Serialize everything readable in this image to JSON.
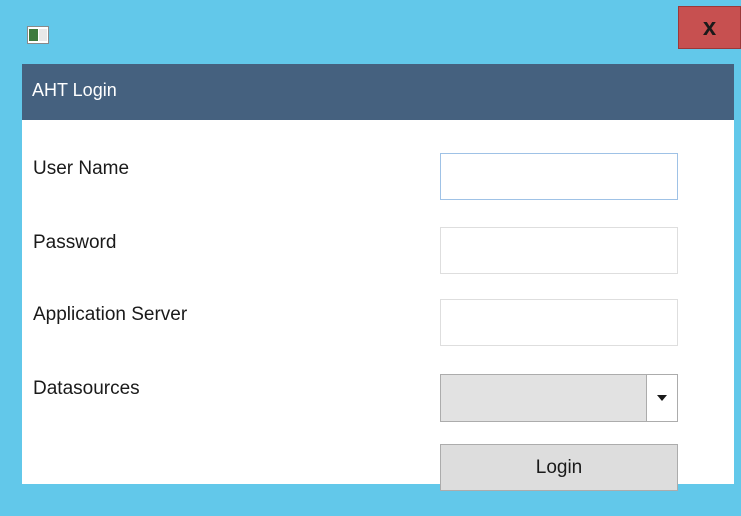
{
  "window": {
    "icon": "app-window-icon",
    "close_icon": "close-icon",
    "close_glyph": "x",
    "frame_color": "#62c8ea",
    "close_color": "#c75050"
  },
  "header": {
    "title": "AHT Login",
    "color": "#45617f"
  },
  "form": {
    "username": {
      "label": "User Name",
      "value": "",
      "placeholder": ""
    },
    "password": {
      "label": "Password",
      "value": "",
      "placeholder": ""
    },
    "app_server": {
      "label": "Application Server",
      "value": "",
      "placeholder": ""
    },
    "datasources": {
      "label": "Datasources",
      "selected": "",
      "arrow_icon": "dropdown-arrow-icon"
    },
    "login_label": "Login"
  }
}
